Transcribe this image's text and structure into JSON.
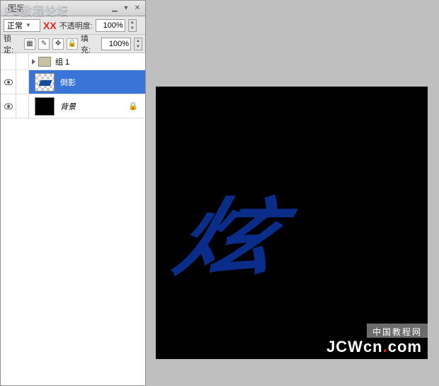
{
  "overlay_title": "PS教程论坛",
  "panel": {
    "tab_label": "图层",
    "xx": "XX",
    "blend_mode": "正常",
    "opacity_label": "不透明度:",
    "opacity_value": "100%",
    "lock_label": "锁定:",
    "fill_label": "填充:",
    "fill_value": "100%"
  },
  "group": {
    "name": "组 1"
  },
  "layers": [
    {
      "name": "倒影",
      "active": true,
      "thumb": "trans"
    },
    {
      "name": "背景",
      "active": false,
      "thumb": "black",
      "locked": true
    }
  ],
  "canvas": {
    "glyph": "炫"
  },
  "watermark": {
    "box": "中国教程网",
    "url_prefix": "JCWcn",
    "url_dot": ".",
    "url_suffix": "com"
  }
}
